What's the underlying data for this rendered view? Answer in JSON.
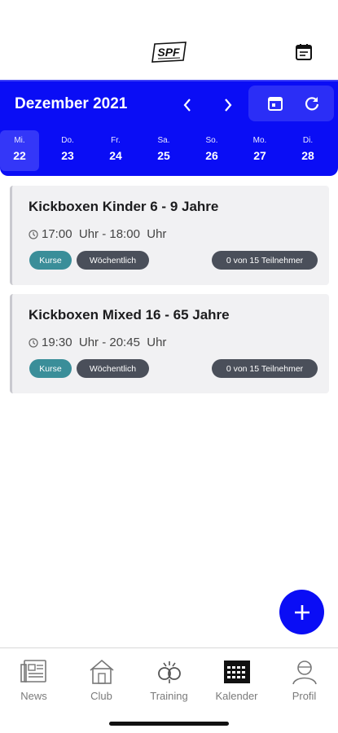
{
  "header": {
    "logo_text": "SPF",
    "icons": [
      "calendar-icon"
    ]
  },
  "calendar": {
    "month_label": "Dezember 2021",
    "days": [
      {
        "name": "Mi.",
        "date": "22",
        "selected": true
      },
      {
        "name": "Do.",
        "date": "23"
      },
      {
        "name": "Fr.",
        "date": "24"
      },
      {
        "name": "Sa.",
        "date": "25"
      },
      {
        "name": "So.",
        "date": "26"
      },
      {
        "name": "Mo.",
        "date": "27"
      },
      {
        "name": "Di.",
        "date": "28"
      }
    ]
  },
  "events": [
    {
      "title": "Kickboxen Kinder 6 - 9 Jahre",
      "time": "17:00  Uhr - 18:00  Uhr",
      "tag_type": "Kurse",
      "tag_freq": "Wöchentlich",
      "participants": "0 von 15 Teilnehmer"
    },
    {
      "title": "Kickboxen Mixed 16 - 65 Jahre",
      "time": "19:30  Uhr - 20:45  Uhr",
      "tag_type": "Kurse",
      "tag_freq": "Wöchentlich",
      "participants": "0 von 15 Teilnehmer"
    }
  ],
  "bottom_nav": [
    {
      "label": "News",
      "icon": "newspaper-icon"
    },
    {
      "label": "Club",
      "icon": "home-icon"
    },
    {
      "label": "Training",
      "icon": "training-icon"
    },
    {
      "label": "Kalender",
      "icon": "calendar-grid-icon",
      "active": true
    },
    {
      "label": "Profil",
      "icon": "profile-icon"
    }
  ],
  "colors": {
    "accent": "#0a0df5",
    "tag_kurse": "#3a8e99",
    "tag_dark": "#4a4f5a"
  }
}
